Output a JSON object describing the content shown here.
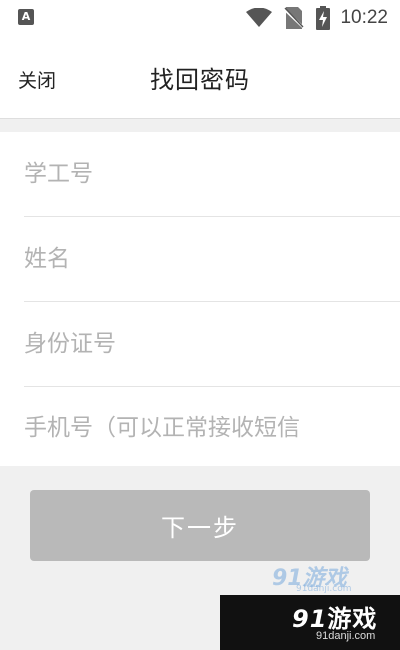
{
  "status_bar": {
    "app_icon_letter": "A",
    "time": "10:22",
    "icons": [
      "wifi-icon",
      "no-sim-icon",
      "battery-charging-icon"
    ]
  },
  "header": {
    "close_label": "关闭",
    "title": "找回密码"
  },
  "form": {
    "fields": [
      {
        "placeholder": "学工号",
        "value": ""
      },
      {
        "placeholder": "姓名",
        "value": ""
      },
      {
        "placeholder": "身份证号",
        "value": ""
      },
      {
        "placeholder": "手机号（可以正常接收短信",
        "value": ""
      }
    ]
  },
  "next_button_label": "下一步",
  "watermark": {
    "faint_number": "91",
    "faint_text": "游戏",
    "faint_url": "91danji.com",
    "logo_number": "91",
    "logo_text": "游戏",
    "url": "91danji.com"
  },
  "colors": {
    "button_disabled": "#b9b9b9",
    "background": "#f0f0f0",
    "placeholder": "#b3b3b3"
  }
}
